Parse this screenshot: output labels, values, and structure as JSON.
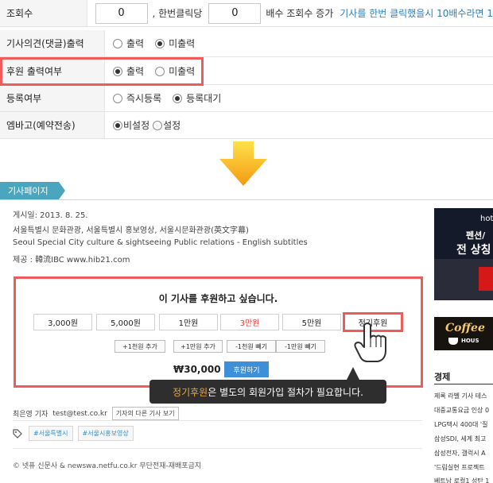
{
  "settings": {
    "rows": [
      {
        "label": "조회수",
        "count_value": "0",
        "text1": ", 한번클릭당",
        "multiplier_value": "0",
        "text2": "배수 조회수 증가",
        "note": "기사를 한번 클릭했을시 10배수라면 1"
      },
      {
        "label": "기사의견(댓글)출력",
        "options": [
          "출력",
          "미출력"
        ],
        "selected": "미출력"
      },
      {
        "label": "후원 출력여부",
        "options": [
          "출력",
          "미출력"
        ],
        "selected": "출력"
      },
      {
        "label": "등록여부",
        "options": [
          "즉시등록",
          "등록대기"
        ],
        "selected": "등록대기"
      },
      {
        "label": "엠바고(예약전송)",
        "options": [
          "비설정",
          "설정"
        ],
        "selected": "비설정"
      }
    ]
  },
  "page_label": "기사페이지",
  "article": {
    "date": "게시일: 2013. 8. 25.",
    "keywords_ko": "서울특별시 문화관광, 서울특별시 홍보영상, 서울시문화관광(英文字幕)",
    "keywords_en": "Seoul Special City culture & sightseeing Public relations - English subtitles",
    "source": "제공 : 韓流IBC www.hib21.com"
  },
  "donation": {
    "title": "이 기사를 후원하고 싶습니다.",
    "amounts": [
      "3,000원",
      "5,000원",
      "1만원",
      "3만원",
      "5만원",
      "정기후원"
    ],
    "highlighted_amount": "3만원",
    "selected_amount": "정기후원",
    "adjust_buttons": [
      "+1천원 추가",
      "+1만원 추가",
      "-1천원 빼기",
      "-1만원 빼기"
    ],
    "total": "₩30,000",
    "donate_button": "후원하기"
  },
  "tooltip": {
    "highlight": "정기후원",
    "text": "은 별도의 회원가입 절차가 필요합니다."
  },
  "reporter": {
    "name": "최은영 기자",
    "email": "test@test.co.kr",
    "more_button": "기자의 다른 기사 보기"
  },
  "tags": [
    "#서울특별시",
    "#서울시홍보영상"
  ],
  "copyright": "© 넷퓨 신문사 & newswa.netfu.co.kr 무단전재-재배포금지",
  "sidebar": {
    "ad1": {
      "line1": "hot",
      "line2": "펜션/",
      "line3": "전 상칭"
    },
    "ad2": {
      "line1": "Coffee",
      "line2": "HOUS"
    },
    "news_heading": "경제",
    "news_items": [
      "제록 라벨 기사 테스",
      "대중교통요금 인상 0",
      "LPG택시 400대 '질",
      "삼성SDI, 세계 최고",
      "삼성전자, 갤럭시 A",
      "'드림실현 프로젝트",
      "베트남 로컬1 성탄 1"
    ]
  },
  "colors": {
    "highlight_red": "#ef5a5a",
    "ribbon": "#49a6be",
    "link_blue": "#2e7fb8",
    "donate_button": "#3d8fd8",
    "tooltip_bg": "#2e2e2e",
    "tooltip_highlight": "#f5a623"
  }
}
